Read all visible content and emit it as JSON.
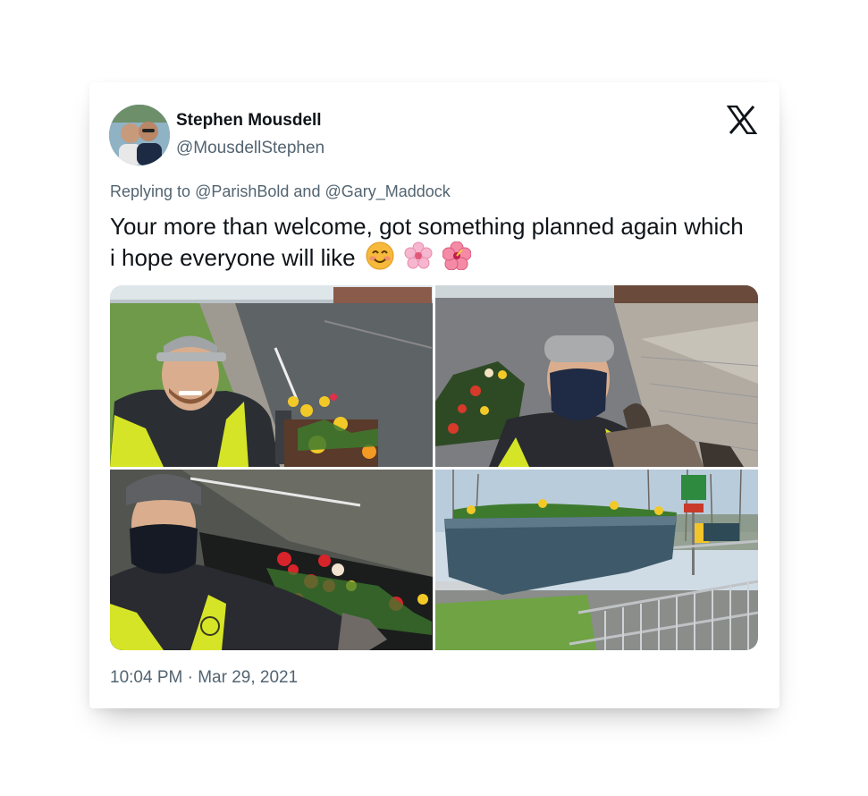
{
  "tweet": {
    "author_name": "Stephen Mousdell",
    "author_handle": "@MousdellStephen",
    "reply_prefix": "Replying to",
    "reply_to_1": "@ParishBold",
    "reply_and": "and",
    "reply_to_2": "@Gary_Maddock",
    "text": "Your more than welcome, got something planned again which i hope everyone will like",
    "emojis": [
      "smiling-face-emoji",
      "cherry-blossom-emoji",
      "hibiscus-emoji"
    ],
    "timestamp": "10:04 PM · Mar 29, 2021"
  },
  "logo": "x-logo-icon",
  "colors": {
    "text": "#0f1419",
    "secondary": "#536471",
    "hiviz": "#d4e820"
  }
}
